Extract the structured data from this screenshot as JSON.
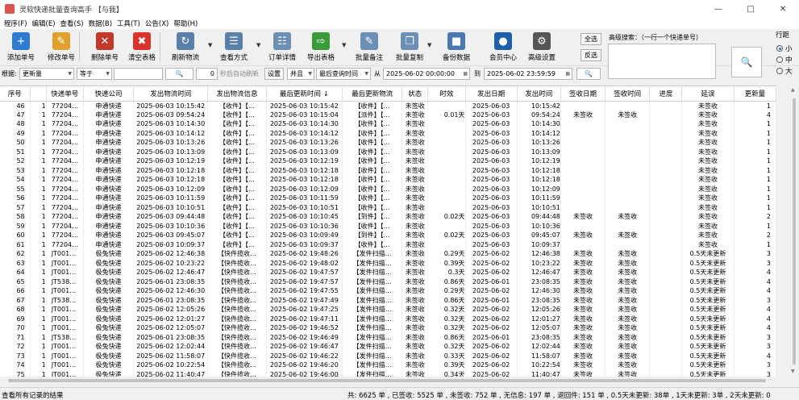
{
  "window": {
    "title": "灵软快递批量查询高手 【与我】"
  },
  "menu": [
    "程序(F)",
    "编辑(E)",
    "查看(S)",
    "数据(B)",
    "工具(T)",
    "公告(X)",
    "帮助(H)"
  ],
  "toolbar": [
    {
      "label": "添加单号",
      "icon": "add-icon",
      "color": "#2e7bcf"
    },
    {
      "label": "修改单号",
      "icon": "edit-icon",
      "color": "#e0a12f"
    },
    {
      "label": "删除单号",
      "icon": "delete-icon",
      "color": "#c0392b"
    },
    {
      "label": "清空表格",
      "icon": "clear-icon",
      "color": "#d9342b"
    },
    {
      "label": "刷新物流",
      "icon": "refresh-icon",
      "color": "#5a7fa8"
    },
    {
      "label": "查看方式",
      "icon": "view-icon",
      "color": "#5a7fa8"
    },
    {
      "label": "订单详情",
      "icon": "details-icon",
      "color": "#6b8fb5"
    },
    {
      "label": "导出表格",
      "icon": "export-icon",
      "color": "#3a9b3a"
    },
    {
      "label": "批量备注",
      "icon": "note-icon",
      "color": "#6b8fb5"
    },
    {
      "label": "批量复制",
      "icon": "copy-icon",
      "color": "#6b8fb5"
    },
    {
      "label": "备份数据",
      "icon": "backup-icon",
      "color": "#4a78b0"
    },
    {
      "label": "会员中心",
      "icon": "member-icon",
      "color": "#1f5fa8"
    },
    {
      "label": "高级设置",
      "icon": "settings-icon",
      "color": "#555555"
    }
  ],
  "side_buttons": {
    "select_all": "全选",
    "invert": "反选"
  },
  "advanced_search": {
    "label": "高级搜索：（一行一个快递单号）"
  },
  "row_spacing": {
    "label": "行距",
    "options": [
      "小",
      "中",
      "大"
    ],
    "selected": "小"
  },
  "filter": {
    "by_label": "根据:",
    "field": "更新量",
    "op": "等于",
    "value": "",
    "seconds": "0",
    "auto_refresh": "秒后自动刷新",
    "settings": "设置",
    "logic": "并且",
    "time_field": "最后查询时间",
    "from_label": "从",
    "from": "2025-06-02 00:00:00",
    "to_label": "到",
    "to": "2025-06-02 23:59:59"
  },
  "table": {
    "headers": [
      "序号",
      "",
      "快递单号",
      "快递公司",
      "发出物流时间",
      "发出物流信息",
      "最后更新时间 ↓",
      "最后更新物流",
      "状态",
      "时效",
      "发出日期",
      "发出时间",
      "签收日期",
      "签收时间",
      "进度",
      "延误",
      "更新量"
    ],
    "rows": [
      [
        "46",
        "1",
        "77204…",
        "申通快递",
        "2025-06-03 10:15:42",
        "【收件】【…",
        "2025-06-03 10:15:42",
        "【收件】【…",
        "未签收",
        "",
        "2025-06-03",
        "10:15:42",
        "",
        "",
        "",
        "未签收",
        "1"
      ],
      [
        "47",
        "1",
        "77204…",
        "申通快递",
        "2025-06-03 09:54:24",
        "【收件】【…",
        "2025-06-03 10:15:04",
        "【派件】【…",
        "未签收",
        "0.01天",
        "2025-06-03",
        "09:54:24",
        "未签收",
        "未签收",
        "",
        "未签收",
        "4"
      ],
      [
        "48",
        "1",
        "77204…",
        "申通快递",
        "2025-06-03 10:14:30",
        "【收件】【…",
        "2025-06-03 10:14:30",
        "【收件】【…",
        "未签收",
        "",
        "2025-06-03",
        "10:14:30",
        "",
        "",
        "",
        "未签收",
        "1"
      ],
      [
        "49",
        "1",
        "77204…",
        "申通快递",
        "2025-06-03 10:14:12",
        "【收件】【…",
        "2025-06-03 10:14:12",
        "【收件】【…",
        "未签收",
        "",
        "2025-06-03",
        "10:14:12",
        "",
        "",
        "",
        "未签收",
        "1"
      ],
      [
        "50",
        "1",
        "77204…",
        "申通快递",
        "2025-06-03 10:13:26",
        "【收件】【…",
        "2025-06-03 10:13:26",
        "【收件】【…",
        "未签收",
        "",
        "2025-06-03",
        "10:13:26",
        "",
        "",
        "",
        "未签收",
        "1"
      ],
      [
        "51",
        "1",
        "77204…",
        "申通快递",
        "2025-06-03 10:13:09",
        "【收件】【…",
        "2025-06-03 10:13:09",
        "【收件】【…",
        "未签收",
        "",
        "2025-06-03",
        "10:13:09",
        "",
        "",
        "",
        "未签收",
        "1"
      ],
      [
        "52",
        "1",
        "77204…",
        "申通快递",
        "2025-06-03 10:12:19",
        "【收件】【…",
        "2025-06-03 10:12:19",
        "【收件】【…",
        "未签收",
        "",
        "2025-06-03",
        "10:12:19",
        "",
        "",
        "",
        "未签收",
        "1"
      ],
      [
        "53",
        "1",
        "77204…",
        "申通快递",
        "2025-06-03 10:12:18",
        "【收件】【…",
        "2025-06-03 10:12:18",
        "【收件】【…",
        "未签收",
        "",
        "2025-06-03",
        "10:12:18",
        "",
        "",
        "",
        "未签收",
        "1"
      ],
      [
        "54",
        "1",
        "77204…",
        "申通快递",
        "2025-06-03 10:12:18",
        "【收件】【…",
        "2025-06-03 10:12:18",
        "【收件】【…",
        "未签收",
        "",
        "2025-06-03",
        "10:12:18",
        "",
        "",
        "",
        "未签收",
        "1"
      ],
      [
        "55",
        "1",
        "77204…",
        "申通快递",
        "2025-06-03 10:12:09",
        "【收件】【…",
        "2025-06-03 10:12:09",
        "【收件】【…",
        "未签收",
        "",
        "2025-06-03",
        "10:12:09",
        "",
        "",
        "",
        "未签收",
        "1"
      ],
      [
        "56",
        "1",
        "77204…",
        "申通快递",
        "2025-06-03 10:11:59",
        "【收件】【…",
        "2025-06-03 10:11:59",
        "【收件】【…",
        "未签收",
        "",
        "2025-06-03",
        "10:11:59",
        "",
        "",
        "",
        "未签收",
        "1"
      ],
      [
        "57",
        "1",
        "77204…",
        "申通快递",
        "2025-06-03 10:10:51",
        "【收件】【…",
        "2025-06-03 10:10:51",
        "【收件】【…",
        "未签收",
        "",
        "2025-06-03",
        "10:10:51",
        "",
        "",
        "",
        "未签收",
        "1"
      ],
      [
        "58",
        "1",
        "77204…",
        "申通快递",
        "2025-06-03 09:44:48",
        "【收件】【…",
        "2025-06-03 10:10:45",
        "【到件】【…",
        "未签收",
        "0.02天",
        "2025-06-03",
        "09:44:48",
        "未签收",
        "未签收",
        "",
        "未签收",
        "2"
      ],
      [
        "59",
        "1",
        "77204…",
        "申通快递",
        "2025-06-03 10:10:36",
        "【收件】【…",
        "2025-06-03 10:10:36",
        "【收件】【…",
        "未签收",
        "",
        "2025-06-03",
        "10:10:36",
        "",
        "",
        "",
        "未签收",
        "1"
      ],
      [
        "60",
        "1",
        "77204…",
        "申通快递",
        "2025-06-03 09:45:07",
        "【收件】【…",
        "2025-06-03 10:09:49",
        "【到件】【…",
        "未签收",
        "0.02天",
        "2025-06-03",
        "09:45:07",
        "未签收",
        "未签收",
        "",
        "未签收",
        "2"
      ],
      [
        "61",
        "1",
        "77204…",
        "申通快递",
        "2025-06-03 10:09:37",
        "【收件】【…",
        "2025-06-03 10:09:37",
        "【收件】【…",
        "未签收",
        "",
        "2025-06-03",
        "10:09:37",
        "",
        "",
        "",
        "未签收",
        "1"
      ],
      [
        "62",
        "1",
        "JT001…",
        "极兔快递",
        "2025-06-02 12:46:38",
        "【快件揽收…",
        "2025-06-02 19:48:26",
        "【发件扫描…",
        "未签收",
        "0.29天",
        "2025-06-02",
        "12:46:38",
        "未签收",
        "未签收",
        "",
        "0.5天未更新",
        "3"
      ],
      [
        "63",
        "1",
        "JT001…",
        "极兔快递",
        "2025-06-02 10:23:22",
        "【快件揽收…",
        "2025-06-02 19:48:02",
        "【发件扫描…",
        "未签收",
        "0.39天",
        "2025-06-02",
        "10:23:22",
        "未签收",
        "未签收",
        "",
        "0.5天未更新",
        "3"
      ],
      [
        "64",
        "1",
        "JT001…",
        "极兔快递",
        "2025-06-02 12:46:47",
        "【快件揽收…",
        "2025-06-02 19:47:57",
        "【发件扫描…",
        "未签收",
        "0.3天",
        "2025-06-02",
        "12:46:47",
        "未签收",
        "未签收",
        "",
        "0.5天未更新",
        "4"
      ],
      [
        "65",
        "1",
        "JT538…",
        "极兔快递",
        "2025-06-01 23:08:35",
        "【快件揽收…",
        "2025-06-02 19:47:57",
        "【发件扫描…",
        "未签收",
        "0.86天",
        "2025-06-01",
        "23:08:35",
        "未签收",
        "未签收",
        "",
        "0.5天未更新",
        "4"
      ],
      [
        "66",
        "1",
        "JT001…",
        "极兔快递",
        "2025-06-02 12:46:30",
        "【快件揽收…",
        "2025-06-02 19:47:55",
        "【发件扫描…",
        "未签收",
        "0.29天",
        "2025-06-02",
        "12:46:30",
        "未签收",
        "未签收",
        "",
        "0.5天未更新",
        "4"
      ],
      [
        "67",
        "1",
        "JT538…",
        "极兔快递",
        "2025-06-01 23:08:35",
        "【快件揽收…",
        "2025-06-02 19:47:49",
        "【发件扫描…",
        "未签收",
        "0.86天",
        "2025-06-01",
        "23:08:35",
        "未签收",
        "未签收",
        "",
        "0.5天未更新",
        "3"
      ],
      [
        "68",
        "1",
        "JT001…",
        "极兔快递",
        "2025-06-02 12:05:26",
        "【快件揽收…",
        "2025-06-02 19:47:25",
        "【发件扫描…",
        "未签收",
        "0.32天",
        "2025-06-02",
        "12:05:26",
        "未签收",
        "未签收",
        "",
        "0.5天未更新",
        "4"
      ],
      [
        "69",
        "1",
        "JT001…",
        "极兔快递",
        "2025-06-02 12:01:27",
        "【快件揽收…",
        "2025-06-02 19:47:11",
        "【发件扫描…",
        "未签收",
        "0.32天",
        "2025-06-02",
        "12:01:27",
        "未签收",
        "未签收",
        "",
        "0.5天未更新",
        "4"
      ],
      [
        "70",
        "1",
        "JT001…",
        "极兔快递",
        "2025-06-02 12:05:07",
        "【快件揽收…",
        "2025-06-02 19:46:52",
        "【发件扫描…",
        "未签收",
        "0.32天",
        "2025-06-02",
        "12:05:07",
        "未签收",
        "未签收",
        "",
        "0.5天未更新",
        "4"
      ],
      [
        "71",
        "1",
        "JT538…",
        "极兔快递",
        "2025-06-01 23:08:35",
        "【快件揽收…",
        "2025-06-02 19:46:49",
        "【发件扫描…",
        "未签收",
        "0.86天",
        "2025-06-01",
        "23:08:35",
        "未签收",
        "未签收",
        "",
        "0.5天未更新",
        "3"
      ],
      [
        "72",
        "1",
        "JT001…",
        "极兔快递",
        "2025-06-02 12:02:44",
        "【快件揽收…",
        "2025-06-02 19:46:47",
        "【发件扫描…",
        "未签收",
        "0.32天",
        "2025-06-02",
        "12:02:44",
        "未签收",
        "未签收",
        "",
        "0.5天未更新",
        "3"
      ],
      [
        "73",
        "1",
        "JT001…",
        "极兔快递",
        "2025-06-02 11:58:07",
        "【快件揽收…",
        "2025-06-02 19:46:22",
        "【发件扫描…",
        "未签收",
        "0.33天",
        "2025-06-02",
        "11:58:07",
        "未签收",
        "未签收",
        "",
        "0.5天未更新",
        "4"
      ],
      [
        "74",
        "1",
        "JT001…",
        "极兔快递",
        "2025-06-02 10:22:54",
        "【快件揽收…",
        "2025-06-02 19:46:20",
        "【发件扫描…",
        "未签收",
        "0.39天",
        "2025-06-02",
        "10:22:54",
        "未签收",
        "未签收",
        "",
        "0.5天未更新",
        "3"
      ],
      [
        "75",
        "1",
        "JT001…",
        "极兔快递",
        "2025-06-02 11:40:47",
        "【快件揽收…",
        "2025-06-02 19:46:00",
        "【发件扫描…",
        "未签收",
        "0.34天",
        "2025-06-02",
        "11:40:47",
        "未签收",
        "未签收",
        "",
        "0.5天未更新",
        "3"
      ]
    ]
  },
  "status": {
    "left": "查看所有记录的结果",
    "right": "共: 6625 单 , 已签收: 5525 单 , 未签收: 752 单 , 无信息: 197 单 , 退回件: 151 单 , 0.5天未更新: 38单 , 1天未更新: 3单 , 2天未更新: 0"
  }
}
